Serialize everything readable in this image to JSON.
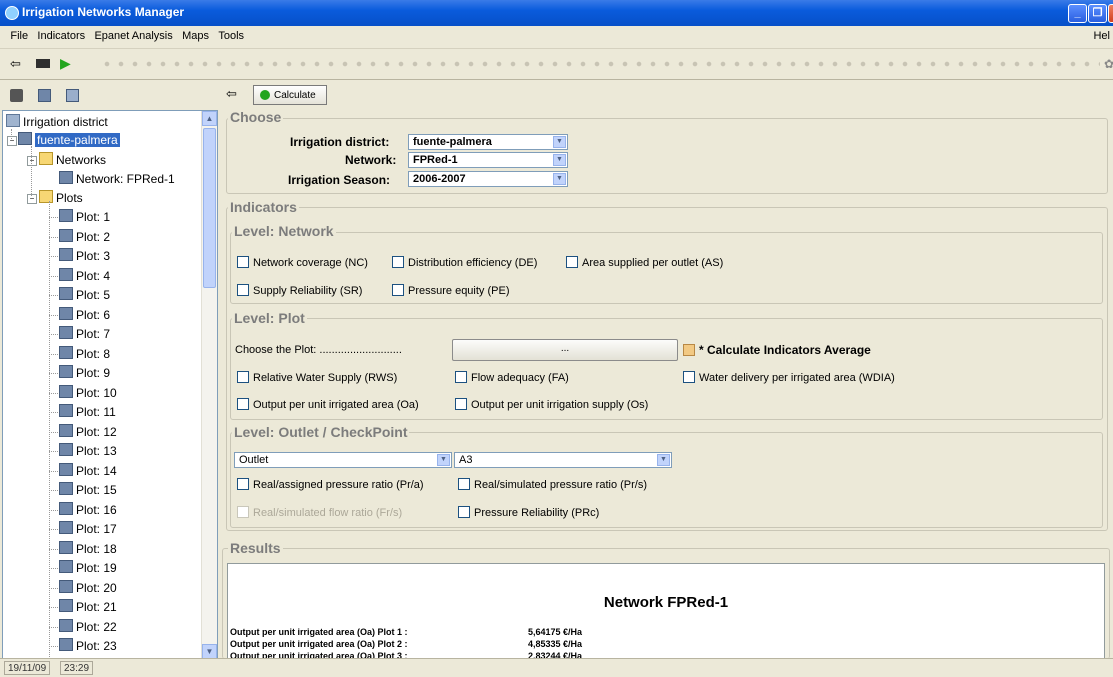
{
  "window": {
    "title": "Irrigation Networks Manager"
  },
  "menu": {
    "items": [
      "File",
      "Indicators",
      "Epanet Analysis",
      "Maps",
      "Tools"
    ],
    "help": "Hel"
  },
  "tree": {
    "root": "Irrigation district",
    "district": "fuente-palmera",
    "networks_folder": "Networks",
    "network": "Network: FPRed-1",
    "plots_folder": "Plots",
    "plots": [
      "Plot: 1",
      "Plot: 2",
      "Plot: 3",
      "Plot: 4",
      "Plot: 5",
      "Plot: 6",
      "Plot: 7",
      "Plot: 8",
      "Plot: 9",
      "Plot: 10",
      "Plot: 11",
      "Plot: 12",
      "Plot: 13",
      "Plot: 14",
      "Plot: 15",
      "Plot: 16",
      "Plot: 17",
      "Plot: 18",
      "Plot: 19",
      "Plot: 20",
      "Plot: 21",
      "Plot: 22",
      "Plot: 23"
    ]
  },
  "toolbar": {
    "calculate_label": "Calculate"
  },
  "choose": {
    "title": "Choose",
    "district_label": "Irrigation district:",
    "district_value": "fuente-palmera",
    "network_label": "Network:",
    "network_value": "FPRed-1",
    "season_label": "Irrigation Season:",
    "season_value": "2006-2007"
  },
  "indicators": {
    "title": "Indicators",
    "network_level": {
      "title": "Level: Network",
      "checks": [
        "Network coverage (NC)",
        "Distribution efficiency (DE)",
        "Area supplied per outlet (AS)",
        "Supply Reliability (SR)",
        "Pressure equity (PE)"
      ]
    },
    "plot_level": {
      "title": "Level: Plot",
      "choose_label": "Choose the Plot: ...........................",
      "choose_button": "...",
      "average_label": "* Calculate Indicators Average",
      "checks": [
        "Relative Water Supply (RWS)",
        "Flow adequacy (FA)",
        "Water delivery per irrigated area (WDIA)",
        "Output per unit irrigated area (Oa)",
        "Output per unit irrigation supply (Os)"
      ]
    },
    "outlet_level": {
      "title": "Level: Outlet / CheckPoint",
      "type_value": "Outlet",
      "id_value": "A3",
      "checks": [
        "Real/assigned pressure ratio (Pr/a)",
        "Real/simulated pressure ratio (Pr/s)",
        "Real/simulated flow ratio (Fr/s)",
        "Pressure Reliability (PRc)"
      ]
    }
  },
  "results": {
    "title": "Results",
    "heading": "Network FPRed-1",
    "rows": [
      {
        "label": "Output per unit irrigated area (Oa) Plot 1 :",
        "value": "5,64175 €/Ha"
      },
      {
        "label": "Output per unit irrigated area (Oa) Plot 2 :",
        "value": "4,85335 €/Ha"
      },
      {
        "label": "Output per unit irrigated area (Oa) Plot 3 :",
        "value": "2,83244 €/Ha"
      }
    ]
  },
  "status": {
    "date": "19/11/09",
    "time": "23:29"
  }
}
